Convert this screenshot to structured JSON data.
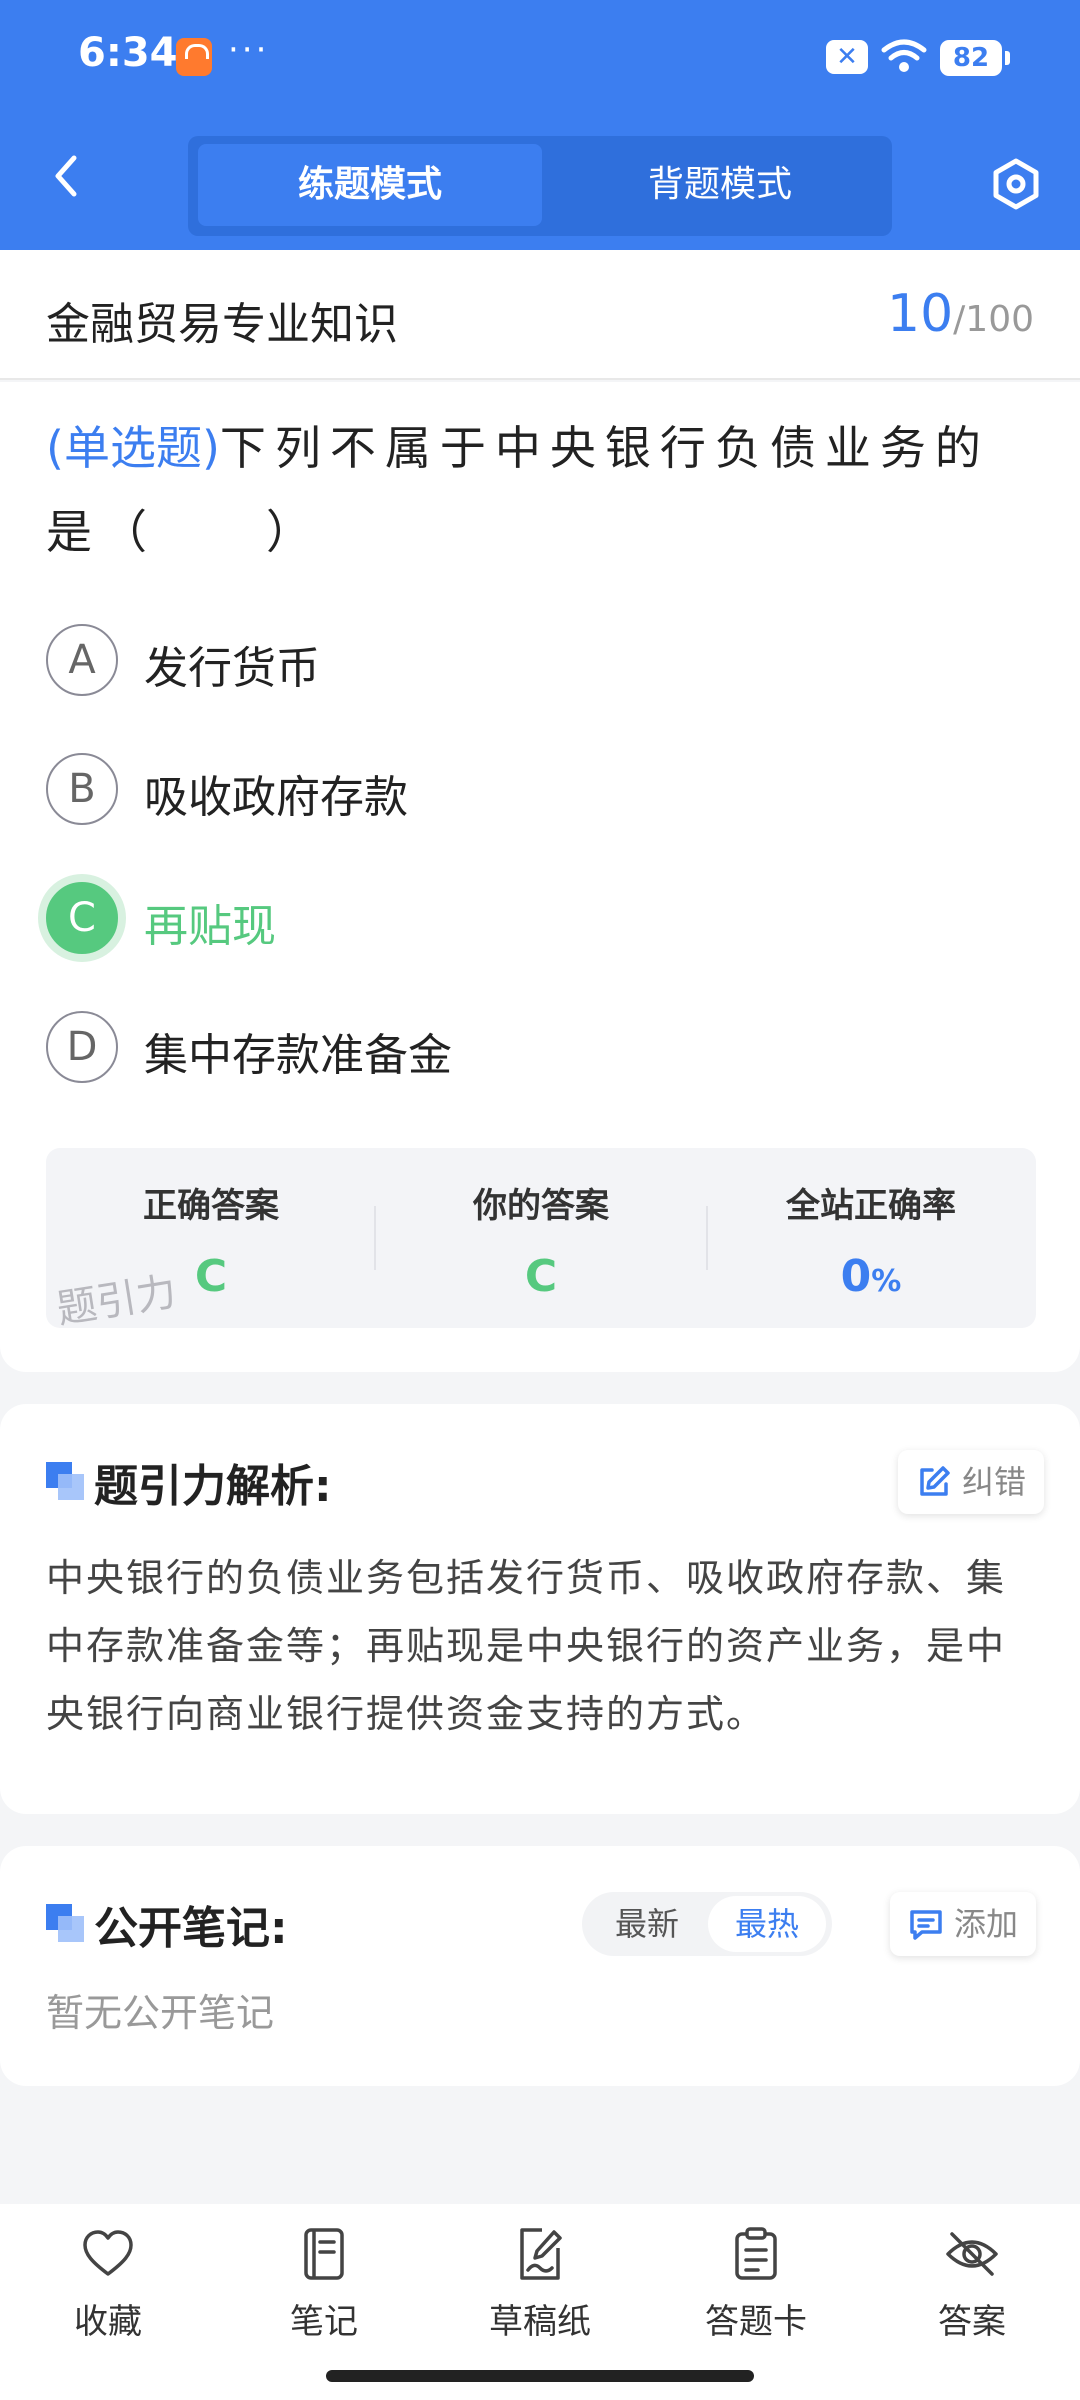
{
  "status": {
    "time": "6:34",
    "dots": "···",
    "battery": "82"
  },
  "nav": {
    "tabs": [
      "练题模式",
      "背题模式"
    ]
  },
  "subject": {
    "title": "金融贸易专业知识",
    "current": "10",
    "total": "/100"
  },
  "question": {
    "type": "(单选题)",
    "text": "下列不属于中央银行负债业务的是（　　）",
    "options": [
      {
        "letter": "A",
        "text": "发行货币"
      },
      {
        "letter": "B",
        "text": "吸收政府存款"
      },
      {
        "letter": "C",
        "text": "再贴现"
      },
      {
        "letter": "D",
        "text": "集中存款准备金"
      }
    ]
  },
  "stats": {
    "correct_label": "正确答案",
    "correct_value": "C",
    "yours_label": "你的答案",
    "yours_value": "C",
    "rate_label": "全站正确率",
    "rate_value": "0",
    "rate_unit": "%",
    "watermark": "题引力"
  },
  "analysis": {
    "title": "题引力解析:",
    "report_label": "纠错",
    "text": "中央银行的负债业务包括发行货币、吸收政府存款、集中存款准备金等；再贴现是中央银行的资产业务，是中央银行向商业银行提供资金支持的方式。"
  },
  "notes": {
    "title": "公开笔记:",
    "sort_latest": "最新",
    "sort_hot": "最热",
    "add_label": "添加",
    "empty": "暂无公开笔记"
  },
  "bottom": {
    "items": [
      {
        "label": "收藏",
        "icon": "heart-icon"
      },
      {
        "label": "笔记",
        "icon": "notebook-icon"
      },
      {
        "label": "草稿纸",
        "icon": "draft-icon"
      },
      {
        "label": "答题卡",
        "icon": "answer-card-icon"
      },
      {
        "label": "答案",
        "icon": "eye-off-icon"
      }
    ]
  },
  "colors": {
    "primary": "#3c7ef0",
    "correct": "#56c97f",
    "store_icon": "#ff7a2e"
  }
}
